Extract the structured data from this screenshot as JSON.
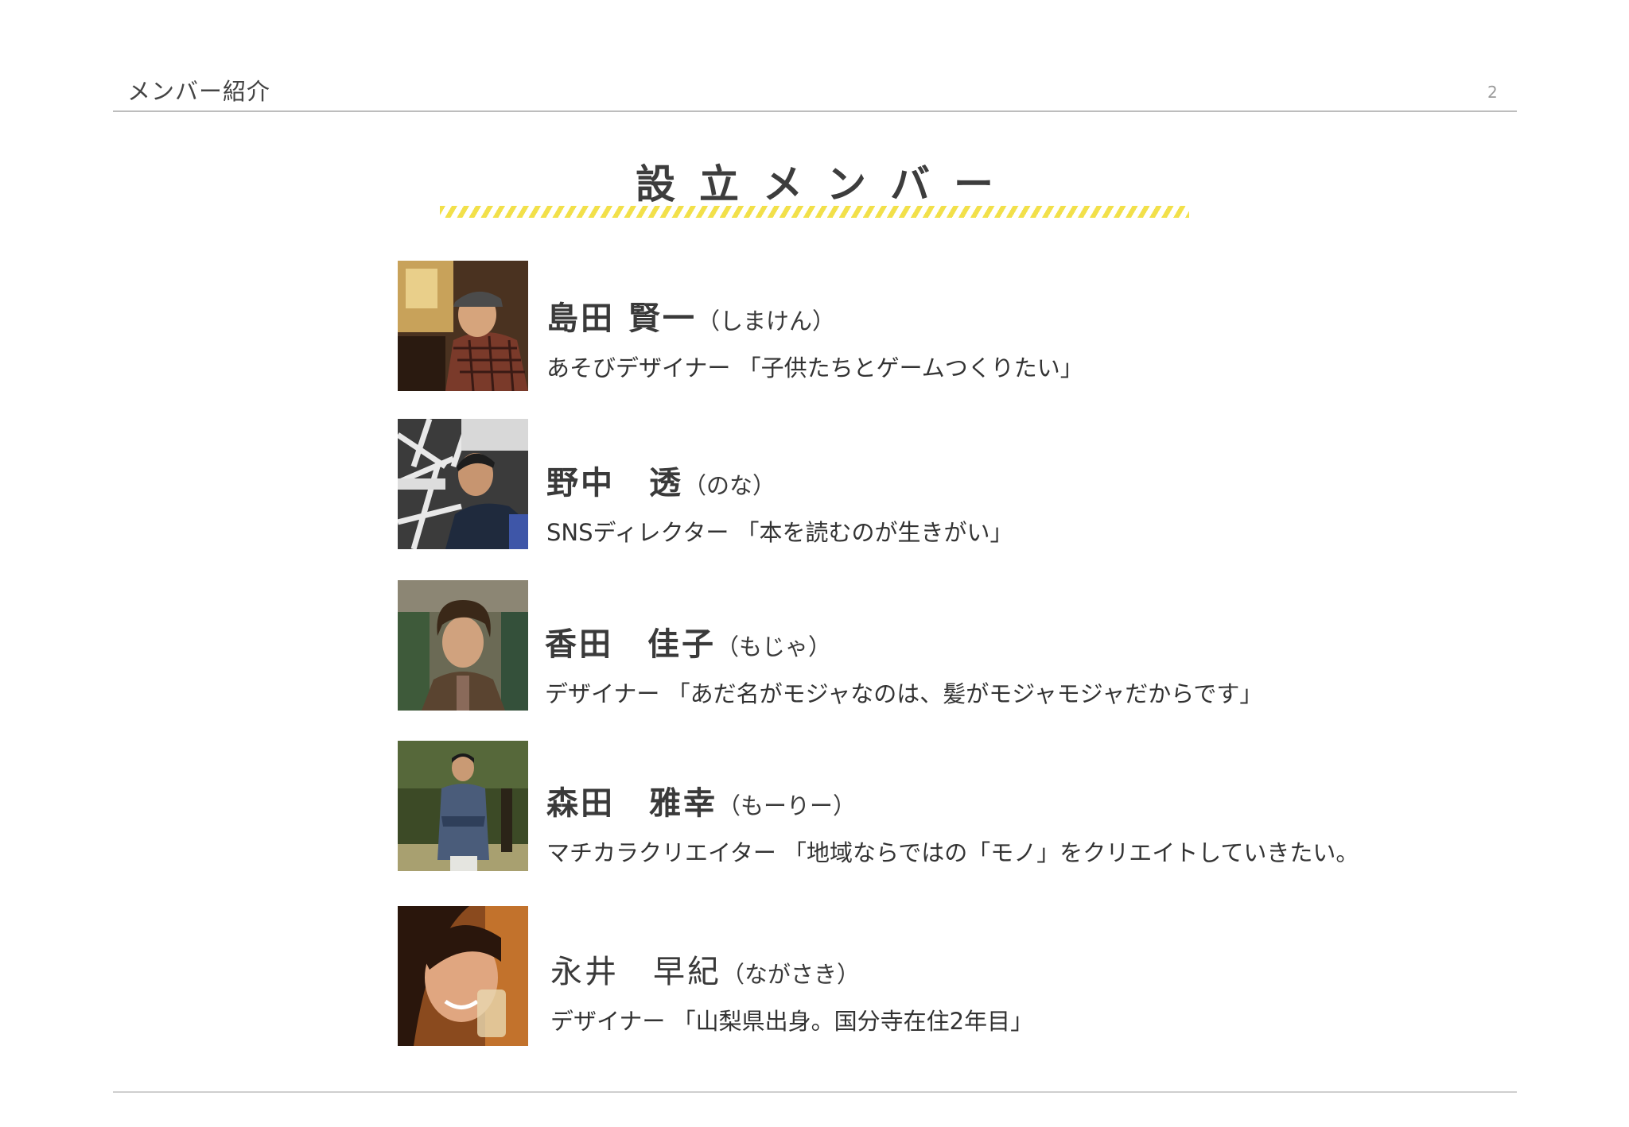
{
  "header": {
    "title": "メンバー紹介",
    "page_number": "2"
  },
  "section": {
    "title": "設立メンバー"
  },
  "members": [
    {
      "name": "島田 賢一",
      "kana": "（しまけん）",
      "description": "あそびデザイナー 「子供たちとゲームつくりたい」"
    },
    {
      "name": "野中　透",
      "kana": "（のな）",
      "description": "SNSディレクター 「本を読むのが生きがい」"
    },
    {
      "name": "香田　佳子",
      "kana": "（もじゃ）",
      "description": "デザイナー 「あだ名がモジャなのは、髪がモジャモジャだからです」"
    },
    {
      "name": "森田　雅幸",
      "kana": "（もーりー）",
      "description": "マチカラクリエイター 「地域ならではの「モノ」をクリエイトしていきたい。"
    },
    {
      "name": "永井　早紀",
      "kana": "（ながさき）",
      "description": "デザイナー 「山梨県出身。国分寺在住2年目」"
    }
  ]
}
